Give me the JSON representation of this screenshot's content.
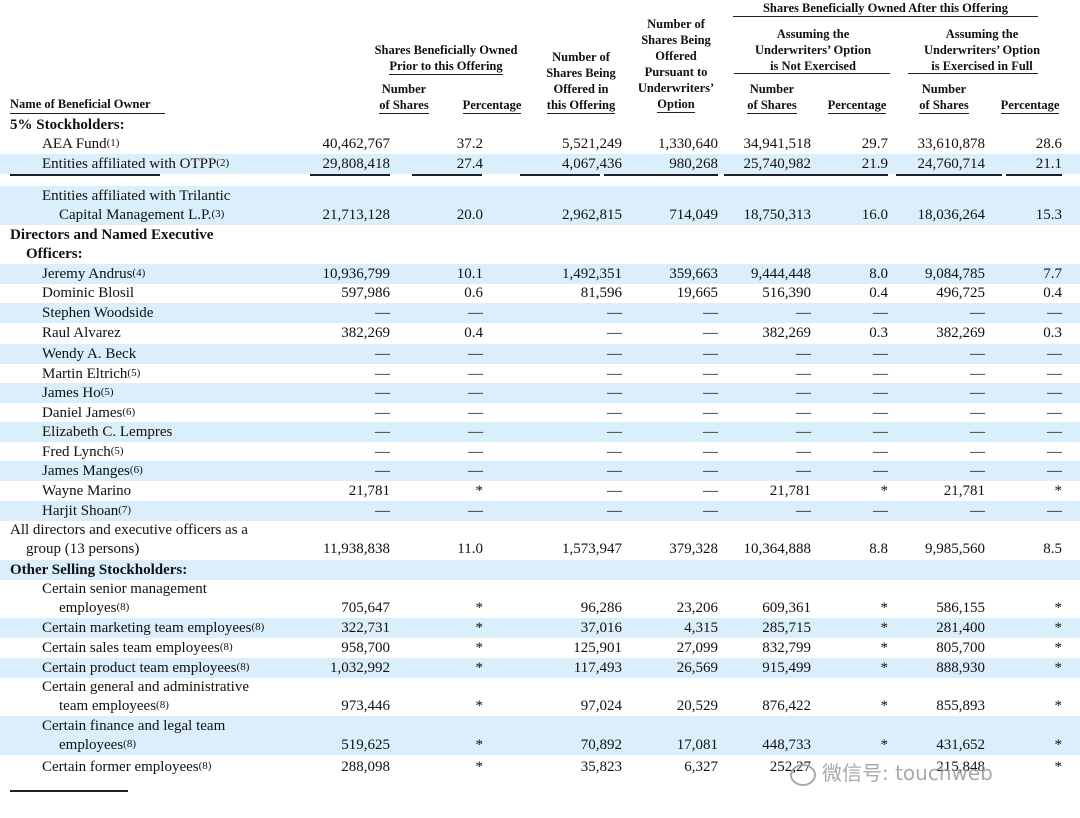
{
  "headers": {
    "owned_after": "Shares Beneficially Owned After this Offering",
    "prior_1": "Shares Beneficially Owned",
    "prior_2": "Prior to this Offering",
    "offered_1": "Number of",
    "offered_2": "Shares Being",
    "offered_3": "Offered in",
    "offered_4": "this Offering",
    "uw_1": "Number of",
    "uw_2": "Shares Being",
    "uw_3": "Offered",
    "uw_4": "Pursuant to",
    "uw_5": "Underwriters’",
    "uw_6": "Option",
    "not_ex_1": "Assuming the",
    "not_ex_2": "Underwriters’ Option",
    "not_ex_3": "is Not Exercised",
    "full_1": "Assuming the",
    "full_2": "Underwriters’ Option",
    "full_3": "is Exercised in Full",
    "number_1": "Number",
    "number_2": "of Shares",
    "percentage": "Percentage",
    "name": "Name of Beneficial Owner"
  },
  "rows": [
    {
      "type": "section",
      "l1": "5% Stockholders:"
    },
    {
      "type": "data",
      "shade": false,
      "name": "AEA Fund",
      "fn": "(1)",
      "v": [
        "40,462,767",
        "37.2",
        "5,521,249",
        "1,330,640",
        "34,941,518",
        "29.7",
        "33,610,878",
        "28.6"
      ]
    },
    {
      "type": "data",
      "shade": true,
      "name": "Entities affiliated with OTPP",
      "fn": "(2)",
      "v": [
        "29,808,418",
        "27.4",
        "4,067,436",
        "980,268",
        "25,740,982",
        "21.9",
        "24,760,714",
        "21.1"
      ]
    },
    {
      "type": "sep"
    },
    {
      "type": "data2",
      "shade": true,
      "l1": "Entities affiliated with Trilantic",
      "l2": "Capital Management L.P.",
      "fn": "(3)",
      "v": [
        "21,713,128",
        "20.0",
        "2,962,815",
        "714,049",
        "18,750,313",
        "16.0",
        "18,036,264",
        "15.3"
      ]
    },
    {
      "type": "section2",
      "l1": "Directors and Named Executive",
      "l2": "Officers:"
    },
    {
      "type": "data",
      "shade": true,
      "name": "Jeremy Andrus",
      "fn": "(4)",
      "v": [
        "10,936,799",
        "10.1",
        "1,492,351",
        "359,663",
        "9,444,448",
        "8.0",
        "9,084,785",
        "7.7"
      ]
    },
    {
      "type": "data",
      "shade": false,
      "name": "Dominic Blosil",
      "fn": "",
      "v": [
        "597,986",
        "0.6",
        "81,596",
        "19,665",
        "516,390",
        "0.4",
        "496,725",
        "0.4"
      ]
    },
    {
      "type": "data",
      "shade": true,
      "name": "Stephen Woodside",
      "fn": "",
      "v": [
        "—",
        "—",
        "—",
        "—",
        "—",
        "—",
        "—",
        "—"
      ]
    },
    {
      "type": "data",
      "shade": false,
      "name": "Raul Alvarez",
      "fn": "",
      "v": [
        "382,269",
        "0.4",
        "—",
        "—",
        "382,269",
        "0.3",
        "382,269",
        "0.3"
      ]
    },
    {
      "type": "data",
      "shade": true,
      "name": "Wendy A. Beck",
      "fn": "",
      "v": [
        "—",
        "—",
        "—",
        "—",
        "—",
        "—",
        "—",
        "—"
      ]
    },
    {
      "type": "data",
      "shade": false,
      "name": "Martin Eltrich",
      "fn": "(5)",
      "v": [
        "—",
        "—",
        "—",
        "—",
        "—",
        "—",
        "—",
        "—"
      ]
    },
    {
      "type": "data",
      "shade": true,
      "name": "James Ho",
      "fn": "(5)",
      "v": [
        "—",
        "—",
        "—",
        "—",
        "—",
        "—",
        "—",
        "—"
      ]
    },
    {
      "type": "data",
      "shade": false,
      "name": "Daniel James",
      "fn": "(6)",
      "v": [
        "—",
        "—",
        "—",
        "—",
        "—",
        "—",
        "—",
        "—"
      ]
    },
    {
      "type": "data",
      "shade": true,
      "name": "Elizabeth C. Lempres",
      "fn": "",
      "v": [
        "—",
        "—",
        "—",
        "—",
        "—",
        "—",
        "—",
        "—"
      ]
    },
    {
      "type": "data",
      "shade": false,
      "name": "Fred Lynch",
      "fn": "(5)",
      "v": [
        "—",
        "—",
        "—",
        "—",
        "—",
        "—",
        "—",
        "—"
      ]
    },
    {
      "type": "data",
      "shade": true,
      "name": "James Manges",
      "fn": "(6)",
      "v": [
        "—",
        "—",
        "—",
        "—",
        "—",
        "—",
        "—",
        "—"
      ]
    },
    {
      "type": "data",
      "shade": false,
      "name": "Wayne Marino",
      "fn": "",
      "v": [
        "21,781",
        "*",
        "—",
        "—",
        "21,781",
        "*",
        "21,781",
        "*"
      ]
    },
    {
      "type": "data",
      "shade": true,
      "name": "Harjit Shoan",
      "fn": "(7)",
      "v": [
        "—",
        "—",
        "—",
        "—",
        "—",
        "—",
        "—",
        "—"
      ]
    },
    {
      "type": "data2",
      "shade": false,
      "flush": true,
      "l1": "All directors and executive officers as a",
      "l2": "group (13 persons)",
      "fn": "",
      "v": [
        "11,938,838",
        "11.0",
        "1,573,947",
        "379,328",
        "10,364,888",
        "8.8",
        "9,985,560",
        "8.5"
      ]
    },
    {
      "type": "section",
      "l1": "Other Selling Stockholders:",
      "shade": true
    },
    {
      "type": "data2",
      "shade": false,
      "l1": "Certain senior management",
      "l2": "employes",
      "fn": "(8)",
      "v": [
        "705,647",
        "*",
        "96,286",
        "23,206",
        "609,361",
        "*",
        "586,155",
        "*"
      ]
    },
    {
      "type": "data",
      "shade": true,
      "name": "Certain marketing team employees",
      "fn": "(8)",
      "v": [
        "322,731",
        "*",
        "37,016",
        "4,315",
        "285,715",
        "*",
        "281,400",
        "*"
      ]
    },
    {
      "type": "data",
      "shade": false,
      "name": "Certain sales team employees",
      "fn": "(8)",
      "v": [
        "958,700",
        "*",
        "125,901",
        "27,099",
        "832,799",
        "*",
        "805,700",
        "*"
      ]
    },
    {
      "type": "data",
      "shade": true,
      "name": "Certain product team employees",
      "fn": "(8)",
      "v": [
        "1,032,992",
        "*",
        "117,493",
        "26,569",
        "915,499",
        "*",
        "888,930",
        "*"
      ]
    },
    {
      "type": "data2",
      "shade": false,
      "l1": "Certain general and administrative",
      "l2": "team employees",
      "fn": "(8)",
      "v": [
        "973,446",
        "*",
        "97,024",
        "20,529",
        "876,422",
        "*",
        "855,893",
        "*"
      ]
    },
    {
      "type": "data2",
      "shade": true,
      "l1": "Certain finance and legal team",
      "l2": "employees",
      "fn": "(8)",
      "v": [
        "519,625",
        "*",
        "70,892",
        "17,081",
        "448,733",
        "*",
        "431,652",
        "*"
      ]
    },
    {
      "type": "data",
      "shade": false,
      "name": "Certain former employees",
      "fn": "(8)",
      "v": [
        "288,098",
        "*",
        "35,823",
        "6,327",
        "252,27",
        "",
        "215,848",
        "*"
      ]
    }
  ],
  "watermark": "微信号: touchweb"
}
